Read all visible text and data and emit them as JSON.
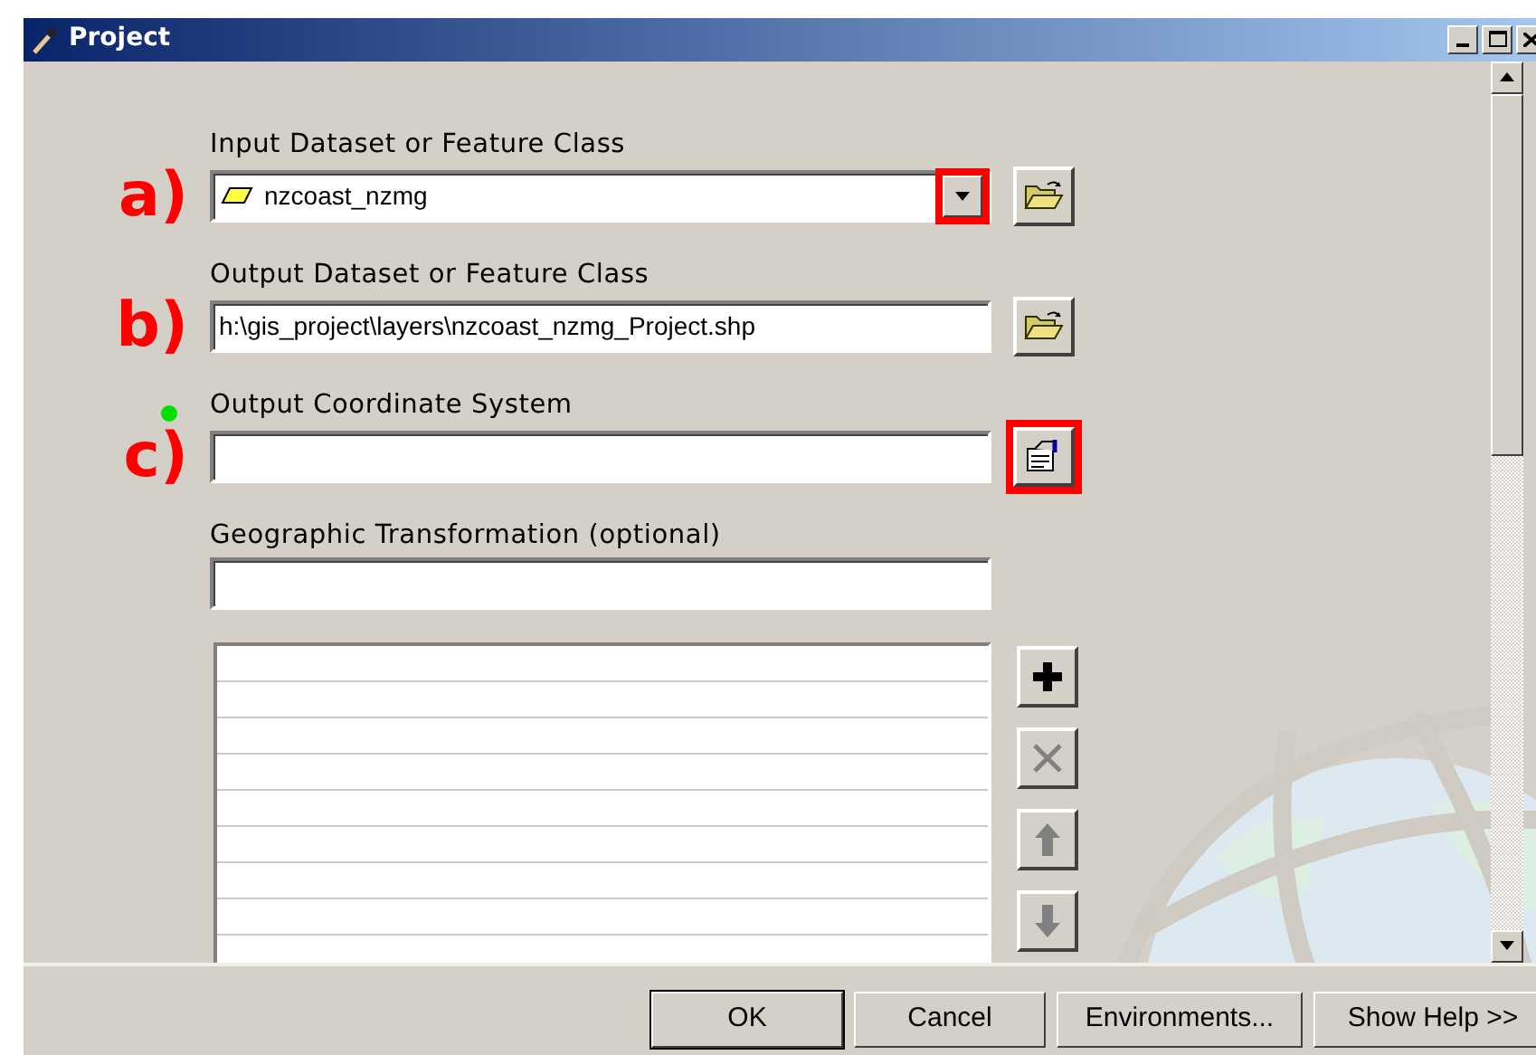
{
  "window": {
    "title": "Project"
  },
  "parameters": [
    {
      "kind": "combo",
      "label": "Input Dataset or Feature Class",
      "value": "nzcoast_nzmg",
      "annotation": "a)",
      "required": false,
      "dropdown_highlighted": true,
      "button": {
        "kind": "browse",
        "highlighted": false
      }
    },
    {
      "kind": "text",
      "label": "Output Dataset or Feature Class",
      "value": "h:\\gis_project\\layers\\nzcoast_nzmg_Project.shp",
      "annotation": "b)",
      "required": false,
      "button": {
        "kind": "browse",
        "highlighted": false
      }
    },
    {
      "kind": "text",
      "label": "Output Coordinate System",
      "annotation": "c)",
      "required": true,
      "button": {
        "kind": "properties",
        "highlighted": true
      }
    },
    {
      "kind": "text",
      "label": "Geographic Transformation (optional)",
      "required": false
    }
  ],
  "list_buttons": [
    {
      "kind": "add",
      "disabled": false
    },
    {
      "kind": "remove",
      "disabled": true
    },
    {
      "kind": "up",
      "disabled": true
    },
    {
      "kind": "down",
      "disabled": true
    }
  ],
  "buttons": [
    {
      "label": "OK",
      "default": true
    },
    {
      "label": "Cancel",
      "default": false
    },
    {
      "label": "Environments...",
      "default": false
    },
    {
      "label": "Show Help >>",
      "default": false
    }
  ]
}
